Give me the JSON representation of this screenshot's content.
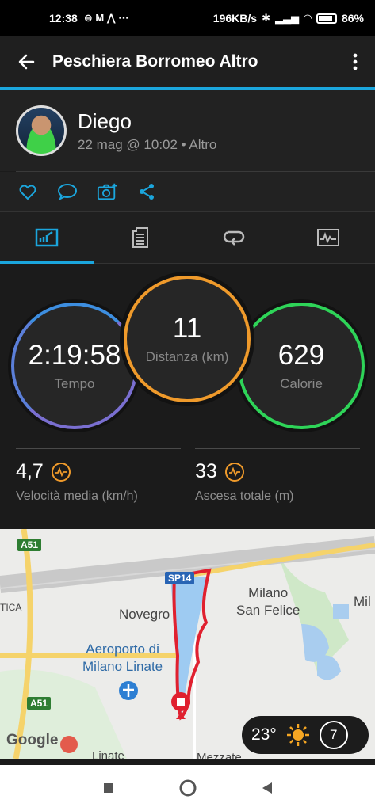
{
  "status_bar": {
    "time": "12:38",
    "notif_icons": "⊜ M ⋀ ⋯",
    "network_speed": "196KB/s",
    "battery": "86"
  },
  "app_bar": {
    "title": "Peschiera Borromeo Altro"
  },
  "profile": {
    "name": "Diego",
    "meta": "22 mag @ 10:02 • Altro"
  },
  "stats": {
    "time": {
      "value": "2:19:58",
      "label": "Tempo"
    },
    "distance": {
      "value": "11",
      "label": "Distanza (km)"
    },
    "calories": {
      "value": "629",
      "label": "Calorie"
    },
    "avg_speed": {
      "value": "4,7",
      "label": "Velocità media (km/h)"
    },
    "total_ascent": {
      "value": "33",
      "label": "Ascesa totale (m)"
    }
  },
  "map": {
    "labels": {
      "milano_san_felice": "Milano\nSan Felice",
      "novegro": "Novegro",
      "airport": "Aeroporto di\nMilano Linate",
      "tica": "TICA",
      "mil": "Mil",
      "linate": "Linate",
      "mezzate": "Mezzate"
    },
    "shields": {
      "a51_top": "A51",
      "a51_bottom": "A51",
      "sp14": "SP14"
    },
    "google": "Google",
    "weather": {
      "temperature": "23°",
      "wind": "7"
    }
  },
  "colors": {
    "accent": "#1ba6dd",
    "distance_ring": "#ef9a2b",
    "calories_ring": "#2ed458",
    "route": "#e0202f"
  }
}
